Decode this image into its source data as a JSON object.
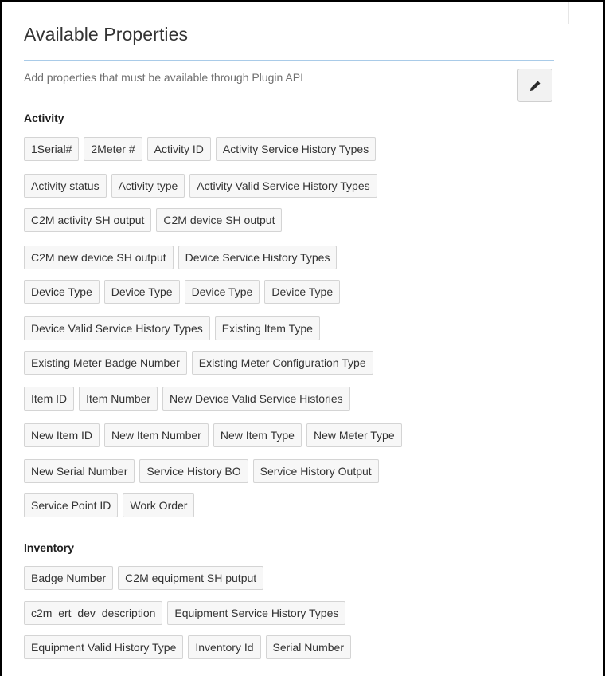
{
  "panel": {
    "title": "Available Properties",
    "subtitle": "Add properties that must be available through Plugin API",
    "edit_icon": "pencil-icon"
  },
  "sections": [
    {
      "heading": "Activity",
      "rows": [
        [
          "1Serial#",
          "2Meter #",
          "Activity ID",
          "Activity Service History Types"
        ],
        [
          "Activity status",
          "Activity type",
          "Activity Valid Service History Types"
        ],
        [
          "C2M activity SH output",
          "C2M device SH output"
        ],
        [
          "C2M new device SH output",
          "Device Service History Types"
        ],
        [
          "Device Type",
          "Device Type",
          "Device Type",
          "Device Type"
        ],
        [
          "Device Valid Service History Types",
          "Existing Item Type"
        ],
        [
          "Existing Meter Badge Number",
          "Existing Meter Configuration Type"
        ],
        [
          "Item ID",
          "Item Number",
          "New Device Valid Service Histories"
        ],
        [
          "New Item ID",
          "New Item Number",
          "New Item Type",
          "New Meter Type"
        ],
        [
          "New Serial Number",
          "Service History BO",
          "Service History Output"
        ],
        [
          "Service Point ID",
          "Work Order"
        ]
      ]
    },
    {
      "heading": "Inventory",
      "rows": [
        [
          "Badge Number",
          "C2M equipment SH putput"
        ],
        [
          "c2m_ert_dev_description",
          "Equipment Service History Types"
        ],
        [
          "Equipment Valid History Type",
          "Inventory Id",
          "Serial Number"
        ]
      ]
    }
  ]
}
